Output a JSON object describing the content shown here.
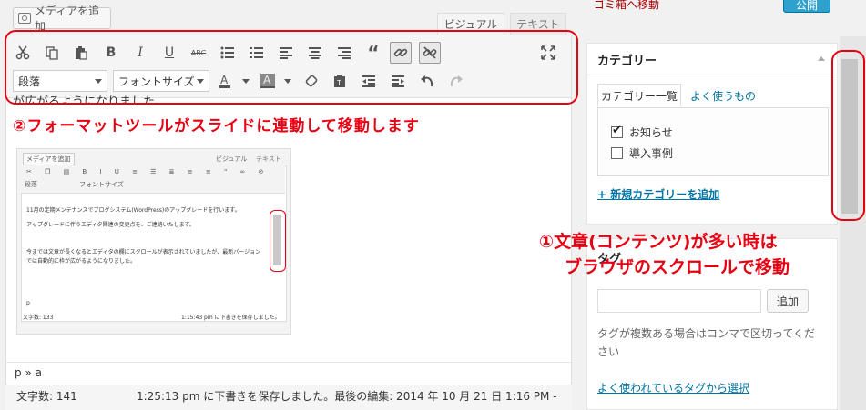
{
  "colors": {
    "annotation_red": "#e60012",
    "link_blue": "#0074a2",
    "publish_blue": "#2ea2cc"
  },
  "header": {
    "media_button": "メディアを追加",
    "tab_visual": "ビジュアル",
    "tab_text": "テキスト",
    "move_to_trash": "ゴミ箱へ移動",
    "publish": "公開"
  },
  "toolbar": {
    "row1_icons": [
      "cut-icon",
      "copy-icon",
      "paste-icon",
      "bold-icon",
      "italic-icon",
      "underline-icon",
      "strikethrough-icon",
      "bullet-list-icon",
      "numbered-list-icon",
      "align-left-icon",
      "align-center-icon",
      "align-right-icon",
      "blockquote-icon",
      "link-icon",
      "unlink-icon",
      "fullscreen-icon"
    ],
    "format_select": "段落",
    "fontsize_select": "フォントサイズ",
    "row2_icons": [
      "text-color-icon",
      "background-color-icon",
      "clear-format-icon",
      "paste-text-icon",
      "outdent-icon",
      "indent-icon",
      "undo-icon",
      "redo-icon"
    ]
  },
  "editor": {
    "cut_off_text": "が広がるようになりました。",
    "path": "p » a",
    "word_count": "文字数: 141",
    "saved_status": "1:25:13 pm に下書きを保存しました。最後の編集: 2014 年 10 月 21 日 1:16 PM -"
  },
  "annotations": {
    "note2": "②フォーマットツールがスライドに連動して移動します",
    "note1_line1": "①文章(コンテンツ)が多い時は",
    "note1_line2": "ブラウザのスクロールで移動"
  },
  "thumbnail": {
    "media_button": "メディアを追加",
    "tab_visual": "ビジュアル",
    "tab_text": "テキスト",
    "format_select": "段落",
    "fontsize_select": "フォントサイズ",
    "line1": "11月の定期メンテナンスでブログシステム(WordPress)のアップグレードを行います。",
    "line2": "アップグレードに伴うエディタ関連の変更点を、ご連絡いたします。",
    "line3": "今までは文章が長くなるとエディタの欄にスクロールが表示されていましたが、最新バージョン",
    "line4": "では自動的に枠が広がるようになりました。",
    "path": "p",
    "word_count": "文字数: 133",
    "saved_status": "1:15:43 pm に下書きを保存しました。"
  },
  "category": {
    "title": "カテゴリー",
    "tab_all": "カテゴリー一覧",
    "tab_popular": "よく使うもの",
    "items": [
      {
        "label": "お知らせ",
        "checked": true
      },
      {
        "label": "導入事例",
        "checked": false
      }
    ],
    "add_new": "+ 新規カテゴリーを追加"
  },
  "tags": {
    "title": "タグ",
    "add_button": "追加",
    "hint": "タグが複数ある場合はコンマで区切ってください",
    "choose_popular": "よく使われているタグから選択"
  }
}
